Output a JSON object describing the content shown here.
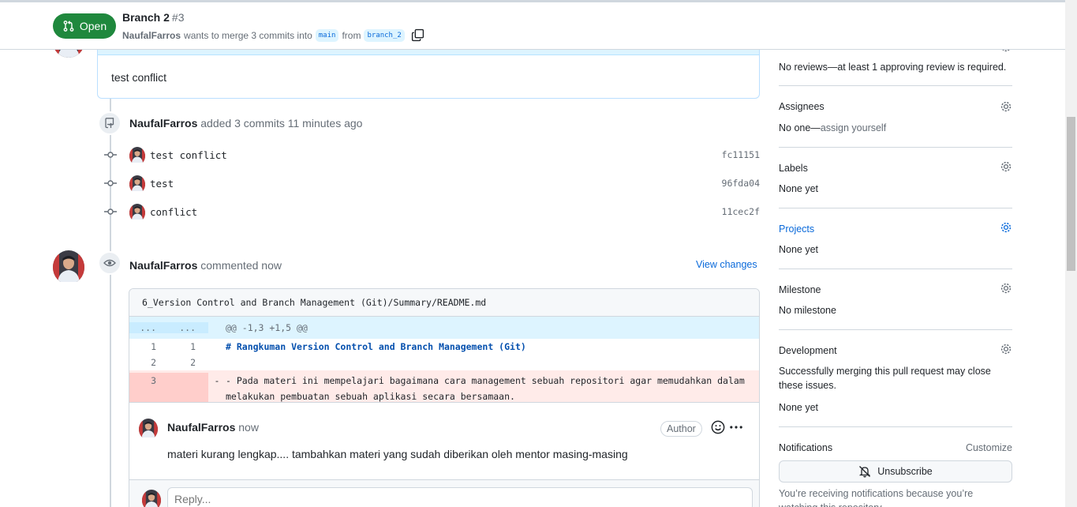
{
  "header": {
    "state_label": "Open",
    "title": "Branch 2",
    "number": "#3",
    "author": "NaufalFarros",
    "merge_text": "wants to merge 3 commits into",
    "base_branch": "main",
    "from_text": "from",
    "head_branch": "branch_2"
  },
  "timeline": {
    "previous_comment_text": "test conflict",
    "commits_event": {
      "actor": "NaufalFarros",
      "text": "added 3 commits 11 minutes ago"
    },
    "commits": [
      {
        "message": "test conflict",
        "sha": "fc11151"
      },
      {
        "message": "test",
        "sha": "96fda04"
      },
      {
        "message": "conflict",
        "sha": "11cec2f"
      }
    ],
    "review_event": {
      "actor": "NaufalFarros",
      "text": "commented now",
      "view_changes": "View changes"
    }
  },
  "review": {
    "file_path": "6_Version Control and Branch Management (Git)/Summary/README.md",
    "hunk": {
      "old": "...",
      "new": "...",
      "header": "@@ -1,3 +1,5 @@"
    },
    "lines": [
      {
        "old": "1",
        "new": "1",
        "sign": "",
        "code": "# Rangkuman Version Control and Branch Management (Git)"
      },
      {
        "old": "2",
        "new": "2",
        "sign": "",
        "code": ""
      },
      {
        "old": "3",
        "new": "",
        "sign": "-",
        "code": "- Pada materi ini mempelajari bagaimana cara management sebuah repositori agar memudahkan dalam melakukan pembuatan sebuah aplikasi secara bersamaan."
      }
    ],
    "comment": {
      "author": "NaufalFarros",
      "time": "now",
      "badge": "Author",
      "body": "materi kurang lengkap.... tambahkan materi yang sudah diberikan oleh mentor masing-masing"
    },
    "reply_placeholder": "Reply..."
  },
  "sidebar": {
    "reviewers_value": "No reviews—at least 1 approving review is required.",
    "assignees": {
      "title": "Assignees",
      "value": "No one—",
      "link": "assign yourself"
    },
    "labels": {
      "title": "Labels",
      "value": "None yet"
    },
    "projects": {
      "title": "Projects",
      "value": "None yet"
    },
    "milestone": {
      "title": "Milestone",
      "value": "No milestone"
    },
    "development": {
      "title": "Development",
      "note": "Successfully merging this pull request may close these issues.",
      "value": "None yet"
    },
    "notifications": {
      "title": "Notifications",
      "customize": "Customize",
      "button": "Unsubscribe",
      "note": "You’re receiving notifications because you’re watching this repository."
    }
  },
  "colors": {
    "open_green": "#1f883d",
    "link_blue": "#0969da",
    "deletion_bg": "#ffebe9"
  },
  "icons": [
    "git-pull-request-icon",
    "copy-icon",
    "repo-push-icon",
    "git-commit-icon",
    "eye-icon",
    "smiley-icon",
    "kebab-horizontal-icon",
    "gear-icon",
    "bell-slash-icon"
  ]
}
